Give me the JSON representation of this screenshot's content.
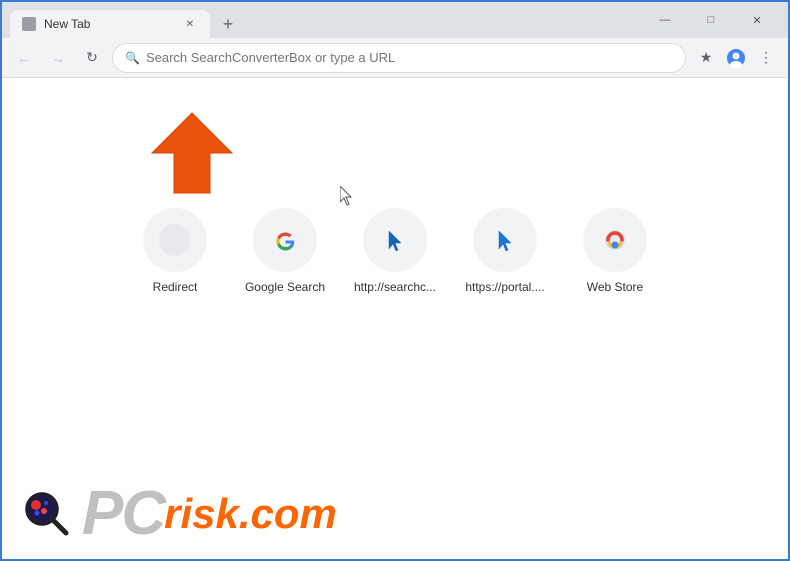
{
  "window": {
    "title": "New Tab",
    "controls": {
      "minimize": "—",
      "maximize": "□",
      "close": "✕"
    }
  },
  "tabs": [
    {
      "label": "New Tab",
      "active": true
    }
  ],
  "toolbar": {
    "address_placeholder": "Search SearchConverterBox or type a URL",
    "address_value": "Search SearchConverterBox or type a URL"
  },
  "speed_dial": {
    "items": [
      {
        "label": "Redirect",
        "type": "blank"
      },
      {
        "label": "Google Search",
        "type": "google"
      },
      {
        "label": "http://searchc...",
        "type": "blue-cursor"
      },
      {
        "label": "https://portal....",
        "type": "blue-cursor"
      },
      {
        "label": "Web Store",
        "type": "webstore"
      }
    ]
  },
  "watermark": {
    "pc": "PC",
    "risk": "risk",
    "dotcom": ".com"
  }
}
